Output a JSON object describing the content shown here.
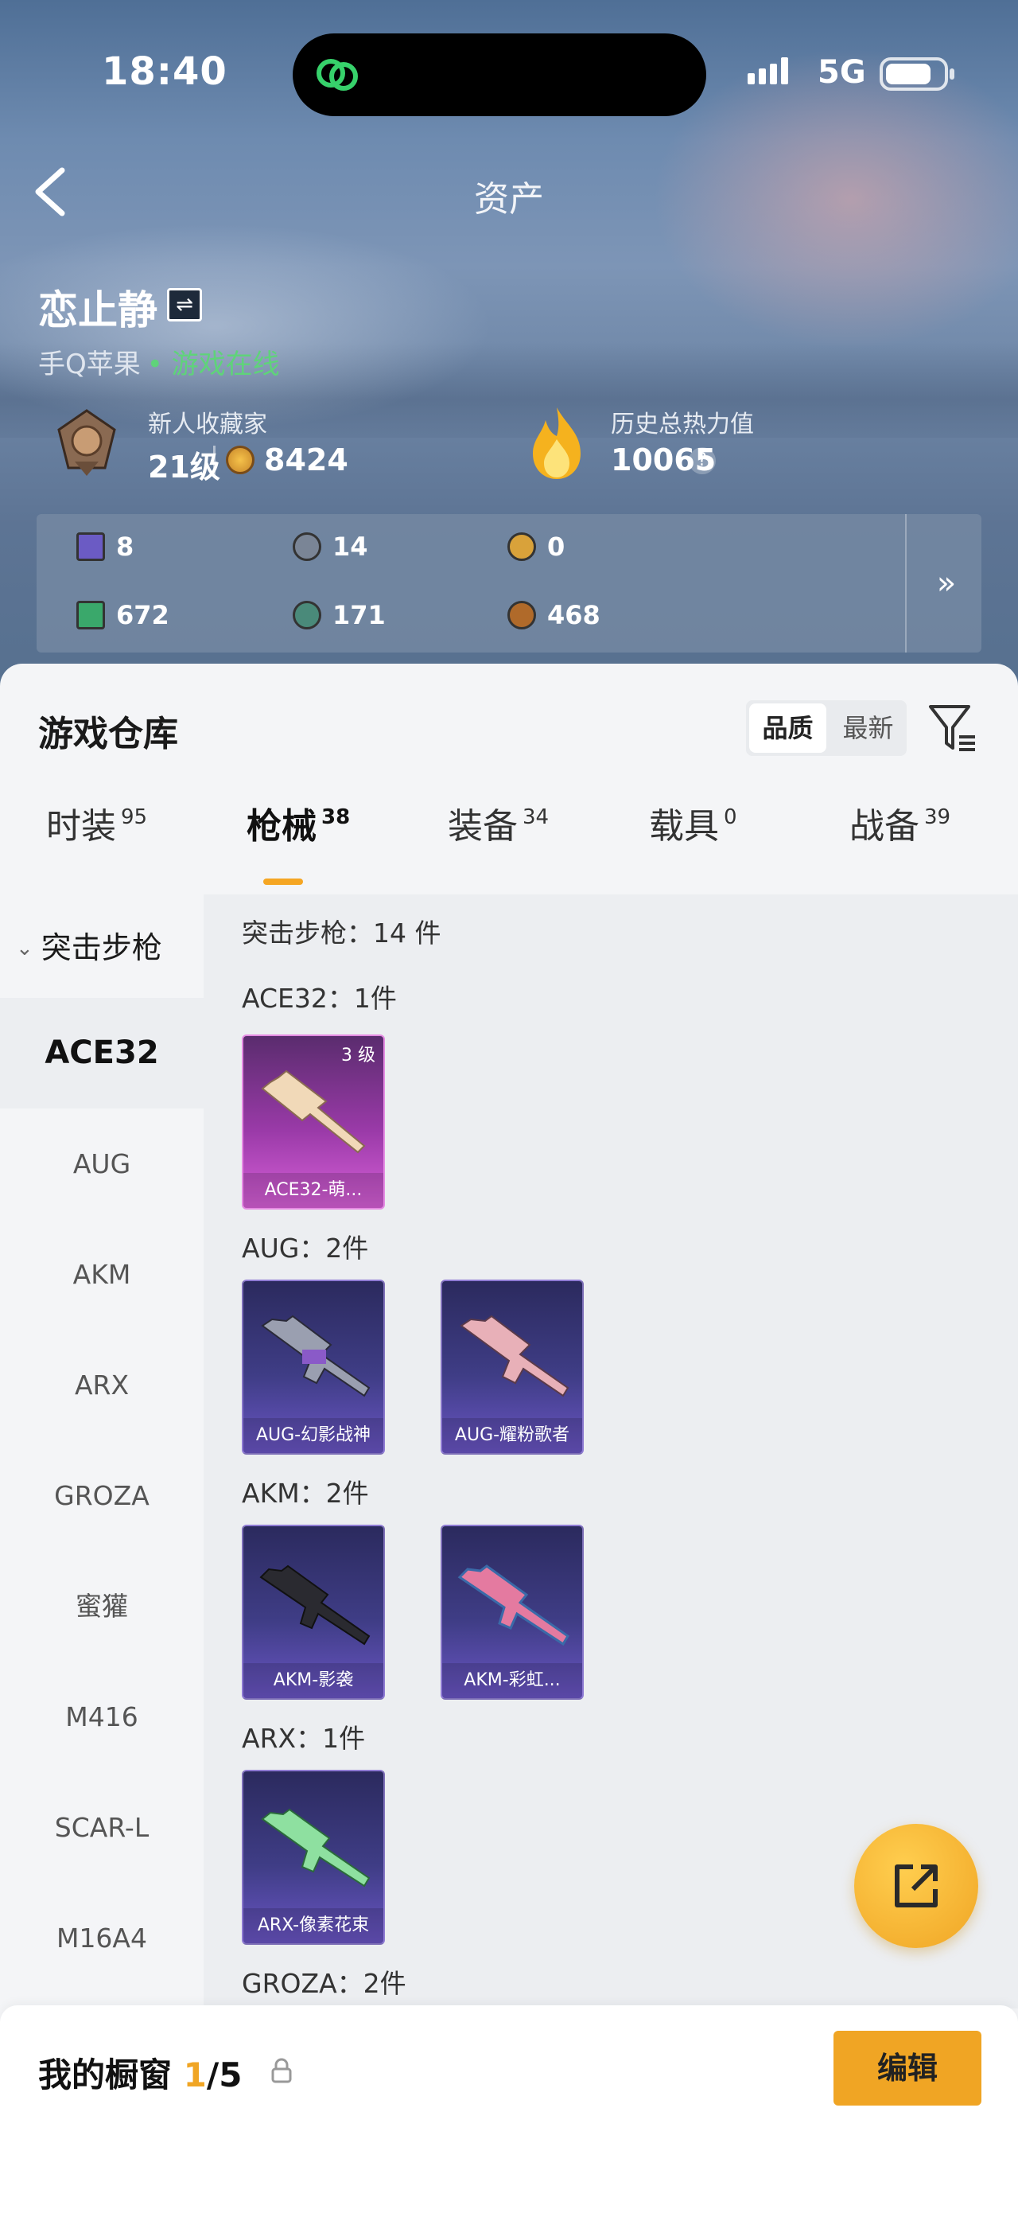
{
  "status_bar": {
    "time": "18:40",
    "network": "5G"
  },
  "nav": {
    "title": "资产"
  },
  "profile": {
    "name": "恋止静",
    "platform": "手Q苹果",
    "online_status": "• 游戏在线",
    "rank_title": "新人收藏家",
    "rank_level": "21级",
    "coins": "8424",
    "heat_title": "历史总热力值",
    "heat_value": "10065",
    "help": "?"
  },
  "stats": [
    {
      "icon": "card-icon",
      "value": "8",
      "color": "#6b5bc4"
    },
    {
      "icon": "silver-badge-icon",
      "value": "14",
      "color": "#7a8596"
    },
    {
      "icon": "gold-badge-icon",
      "value": "0",
      "color": "#d9a23a"
    },
    {
      "icon": "green-card-icon",
      "value": "672",
      "color": "#3aa86b"
    },
    {
      "icon": "sphere-icon",
      "value": "171",
      "color": "#4a8a7a"
    },
    {
      "icon": "bronze-coin-icon",
      "value": "468",
      "color": "#b06a2a"
    }
  ],
  "stats_more": "»",
  "warehouse": {
    "title": "游戏仓库",
    "sort_quality": "品质",
    "sort_newest": "最新",
    "tabs": [
      {
        "label": "时装",
        "count": "95"
      },
      {
        "label": "枪械",
        "count": "38"
      },
      {
        "label": "装备",
        "count": "34"
      },
      {
        "label": "载具",
        "count": "0"
      },
      {
        "label": "战备",
        "count": "39"
      }
    ],
    "category_group": "突击步枪",
    "categories": [
      "ACE32",
      "AUG",
      "AKM",
      "ARX",
      "GROZA",
      "蜜獾",
      "M416",
      "SCAR-L",
      "M16A4"
    ],
    "summary": "突击步枪：14 件",
    "sections": [
      {
        "header": "ACE32：1件",
        "items": [
          {
            "name": "ACE32-萌...",
            "level": "3 级",
            "rarity": "pink"
          }
        ]
      },
      {
        "header": "AUG：2件",
        "items": [
          {
            "name": "AUG-幻影战神",
            "rarity": "purple"
          },
          {
            "name": "AUG-耀粉歌者",
            "rarity": "purple"
          }
        ]
      },
      {
        "header": "AKM：2件",
        "items": [
          {
            "name": "AKM-影袭",
            "rarity": "purple"
          },
          {
            "name": "AKM-彩虹...",
            "rarity": "purple"
          }
        ]
      },
      {
        "header": "ARX：1件",
        "items": [
          {
            "name": "ARX-像素花束",
            "rarity": "purple"
          }
        ]
      },
      {
        "header": "GROZA：2件",
        "items": []
      }
    ]
  },
  "showcase": {
    "title": "我的橱窗 ",
    "current": "1",
    "total": "/5",
    "edit_label": "编辑"
  },
  "colors": {
    "accent": "#f0a524",
    "online": "#5fd37a"
  }
}
